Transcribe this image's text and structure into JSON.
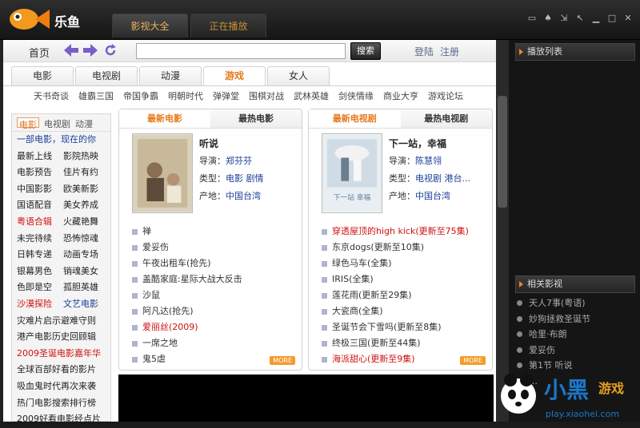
{
  "app": {
    "name": "乐鱼",
    "tabs": [
      "影视大全",
      "正在播放"
    ]
  },
  "nav": {
    "home": "首页",
    "search": "搜索",
    "login": "登陆",
    "register": "注册"
  },
  "categories": [
    "电影",
    "电视剧",
    "动漫",
    "游戏",
    "女人"
  ],
  "subnav": [
    "天书奇谈",
    "雄霸三国",
    "帝国争霸",
    "明朝时代",
    "弹弹堂",
    "围棋对战",
    "武林英雄",
    "剑侠情缘",
    "商业大亨",
    "游戏论坛"
  ],
  "left": {
    "tabs": [
      "电影",
      "电视剧",
      "动漫"
    ],
    "links": [
      {
        "t": "一部电影，现在的你",
        "c": "blue",
        "span": 2
      },
      {
        "t": "最新上线",
        "c": "def"
      },
      {
        "t": "影院热映",
        "c": "def"
      },
      {
        "t": "电影预告",
        "c": "def"
      },
      {
        "t": "佳片有约",
        "c": "def"
      },
      {
        "t": "中国影影",
        "c": "def"
      },
      {
        "t": "欧美新影",
        "c": "def"
      },
      {
        "t": "国语配音",
        "c": "def"
      },
      {
        "t": "美女养成",
        "c": "def"
      },
      {
        "t": "粤语合辑",
        "c": "red"
      },
      {
        "t": "火藏艳舞",
        "c": "def"
      },
      {
        "t": "未完待续",
        "c": "def"
      },
      {
        "t": "恐怖惊魂",
        "c": "def"
      },
      {
        "t": "日韩专递",
        "c": "def"
      },
      {
        "t": "动画专场",
        "c": "def"
      },
      {
        "t": "银幕男色",
        "c": "def"
      },
      {
        "t": "销魂美女",
        "c": "def"
      },
      {
        "t": "色即是空",
        "c": "def"
      },
      {
        "t": "孤胆英雄",
        "c": "def"
      },
      {
        "t": "沙漠探险",
        "c": "red"
      },
      {
        "t": "文艺电影",
        "c": "blue"
      },
      {
        "t": "灾难片启示避难守则",
        "c": "def",
        "span": 2
      },
      {
        "t": "港产电影历史回顾辑",
        "c": "def",
        "span": 2
      },
      {
        "t": "2009圣诞电影嘉年华",
        "c": "red",
        "span": 2
      },
      {
        "t": "全球百部好看的影片",
        "c": "def",
        "span": 2
      },
      {
        "t": "吸血鬼时代再次来袭",
        "c": "def",
        "span": 2
      },
      {
        "t": "热门电影搜索排行榜",
        "c": "def",
        "span": 2
      },
      {
        "t": "2009好看电影经点片",
        "c": "def",
        "span": 2
      }
    ]
  },
  "card1": {
    "tabs": [
      "最新电影",
      "最热电影"
    ],
    "title": "听说",
    "director_label": "导演：",
    "director": "郑芬芬",
    "type_label": "类型：",
    "type": "电影 剧情",
    "origin_label": "产地：",
    "origin": "中国台湾",
    "items": [
      {
        "t": "禅",
        "red": false
      },
      {
        "t": "爱妥伤",
        "red": false
      },
      {
        "t": "午夜出租车(抢先)",
        "red": false
      },
      {
        "t": "盖酷家庭:星际大战大反击",
        "red": false
      },
      {
        "t": "沙鼠",
        "red": false
      },
      {
        "t": "阿凡达(抢先)",
        "red": false
      },
      {
        "t": "爱丽丝(2009)",
        "red": true
      },
      {
        "t": "一席之地",
        "red": false
      },
      {
        "t": "鬼5虐",
        "red": false
      }
    ],
    "more": "MORE"
  },
  "card2": {
    "tabs": [
      "最新电视剧",
      "最热电视剧"
    ],
    "title": "下一站，幸福",
    "director_label": "导演：",
    "director": "陈慧翎",
    "type_label": "类型：",
    "type": "电视剧 港台...",
    "origin_label": "产地：",
    "origin": "中国台湾",
    "items": [
      {
        "t": "穿透屋顶的high kick(更新至75集)",
        "red": true
      },
      {
        "t": "东京dogs(更新至10集)",
        "red": false
      },
      {
        "t": "绿色马车(全集)",
        "red": false
      },
      {
        "t": "IRIS(全集)",
        "red": false
      },
      {
        "t": "莲花雨(更新至29集)",
        "red": false
      },
      {
        "t": "大瓷商(全集)",
        "red": false
      },
      {
        "t": "圣诞节会下雪吗(更新至8集)",
        "red": false
      },
      {
        "t": "终极三国(更新至44集)",
        "red": false
      },
      {
        "t": "海派甜心(更新至9集)",
        "red": true
      }
    ],
    "more": "MORE"
  },
  "right": {
    "playlist": "播放列表",
    "related": "相关影视",
    "items": [
      "天人7事(粤语)",
      "妙狗拯救圣诞节",
      "哈里·布朗",
      "爱妥伤",
      "第1节 听说",
      "…"
    ]
  },
  "colors": {
    "accent": "#e8791c",
    "red": "#d01010",
    "blue": "#1b3d9a"
  }
}
